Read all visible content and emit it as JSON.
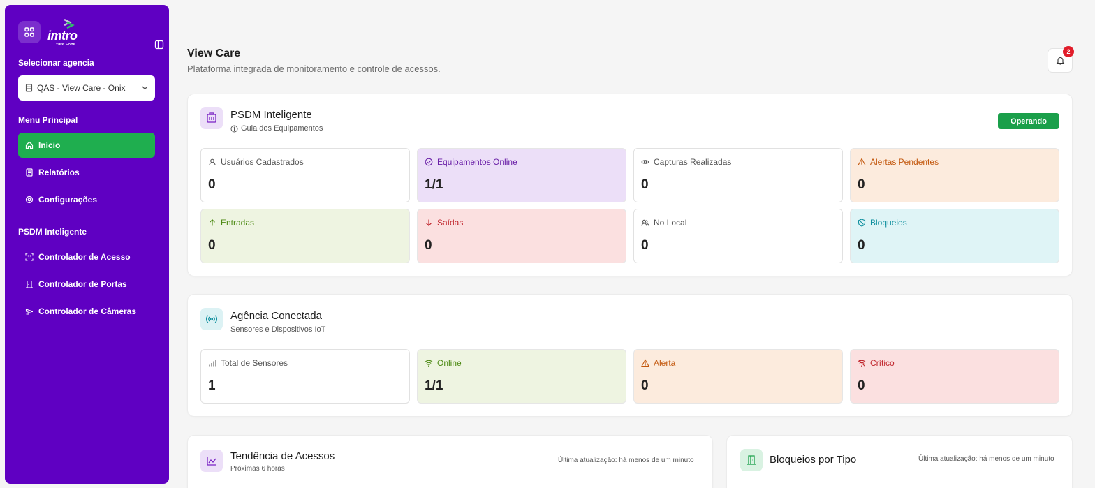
{
  "sidebar": {
    "brand": {
      "logo_text": "imtro",
      "logo_sub": "VIEW CARE"
    },
    "agency_label": "Selecionar agencia",
    "agency_value": "QAS - View Care - Onix",
    "menu_label": "Menu Principal",
    "menu_items": [
      {
        "label": "Início",
        "icon": "home-icon",
        "active": true
      },
      {
        "label": "Relatórios",
        "icon": "report-icon",
        "active": false
      },
      {
        "label": "Configurações",
        "icon": "settings-icon",
        "active": false
      }
    ],
    "psdm_label": "PSDM Inteligente",
    "psdm_items": [
      {
        "label": "Controlador de Acesso",
        "icon": "scan-icon"
      },
      {
        "label": "Controlador de Portas",
        "icon": "door-icon"
      },
      {
        "label": "Controlador de Câmeras",
        "icon": "camera-icon"
      }
    ]
  },
  "header": {
    "title": "View Care",
    "subtitle": "Plataforma integrada de monitoramento e controle de acessos.",
    "notifications": "2"
  },
  "psdm_card": {
    "title": "PSDM Inteligente",
    "subtitle": "Guia dos Equipamentos",
    "status": "Operando",
    "stats": [
      {
        "label": "Usuários Cadastrados",
        "value": "0",
        "icon": "users-icon",
        "color": "#555555",
        "bg": "#ffffff"
      },
      {
        "label": "Equipamentos Online",
        "value": "1/1",
        "icon": "check-circle-icon",
        "color": "#6b21a8",
        "bg": "#ecdff8"
      },
      {
        "label": "Capturas Realizadas",
        "value": "0",
        "icon": "eye-icon",
        "color": "#555555",
        "bg": "#ffffff"
      },
      {
        "label": "Alertas Pendentes",
        "value": "0",
        "icon": "warning-icon",
        "color": "#c2560b",
        "bg": "#fcebdd"
      },
      {
        "label": "Entradas",
        "value": "0",
        "icon": "arrow-up-icon",
        "color": "#4d8a14",
        "bg": "#eef4e1"
      },
      {
        "label": "Saídas",
        "value": "0",
        "icon": "arrow-down-icon",
        "color": "#c0262d",
        "bg": "#fbe0e0"
      },
      {
        "label": "No Local",
        "value": "0",
        "icon": "people-icon",
        "color": "#555555",
        "bg": "#ffffff"
      },
      {
        "label": "Bloqueios",
        "value": "0",
        "icon": "shield-icon",
        "color": "#0f8f9e",
        "bg": "#dff4f6"
      }
    ]
  },
  "agency_card": {
    "title": "Agência Conectada",
    "subtitle": "Sensores e Dispositivos IoT",
    "stats": [
      {
        "label": "Total de Sensores",
        "value": "1",
        "icon": "bars-icon",
        "color": "#555555",
        "bg": "#ffffff"
      },
      {
        "label": "Online",
        "value": "1/1",
        "icon": "wifi-icon",
        "color": "#4d8a14",
        "bg": "#eef4e1"
      },
      {
        "label": "Alerta",
        "value": "0",
        "icon": "warning-icon",
        "color": "#c2560b",
        "bg": "#fcebdd"
      },
      {
        "label": "Crítico",
        "value": "0",
        "icon": "wifi-off-icon",
        "color": "#c0262d",
        "bg": "#fbe0e0"
      }
    ]
  },
  "trend_card": {
    "title": "Tendência de Acessos",
    "subtitle": "Próximas 6 horas",
    "updated": "Última atualização: há menos de um minuto"
  },
  "blocks_card": {
    "title": "Bloqueios por Tipo",
    "updated": "Última atualização: há menos de um minuto"
  },
  "colors": {
    "sidebar": "#5f00c2",
    "active_nav": "#1fae4f",
    "status_pill": "#1a9f4a",
    "badge": "#e11d2a"
  }
}
